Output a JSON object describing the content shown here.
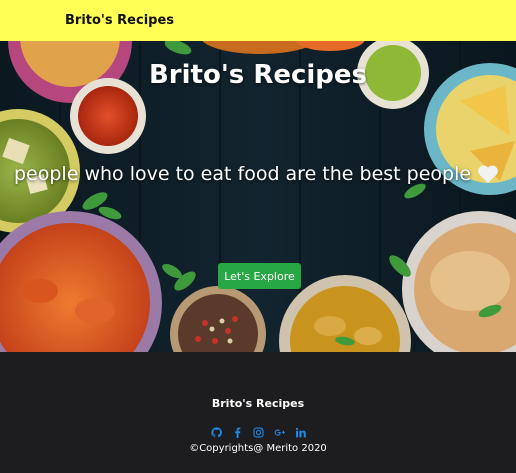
{
  "navbar": {
    "brand": "Brito's Recipes"
  },
  "hero": {
    "title": "Brito's Recipes",
    "tagline": "people who love to eat food are the best people",
    "tagline_icon": "heart-icon",
    "button_label": "Let's Explore",
    "button_color": "#28a745"
  },
  "footer": {
    "brand": "Brito's Recipes",
    "social": [
      {
        "icon": "github-icon"
      },
      {
        "icon": "facebook-icon"
      },
      {
        "icon": "instagram-icon"
      },
      {
        "icon": "google-plus-icon"
      },
      {
        "icon": "linkedin-icon"
      }
    ],
    "social_color": "#1e88e5",
    "copyright": "©Copyrights@ Merito 2020"
  },
  "colors": {
    "navbar_bg": "#ffff55",
    "footer_bg": "#1d1d1f",
    "hero_bg": "#0d1b24"
  }
}
